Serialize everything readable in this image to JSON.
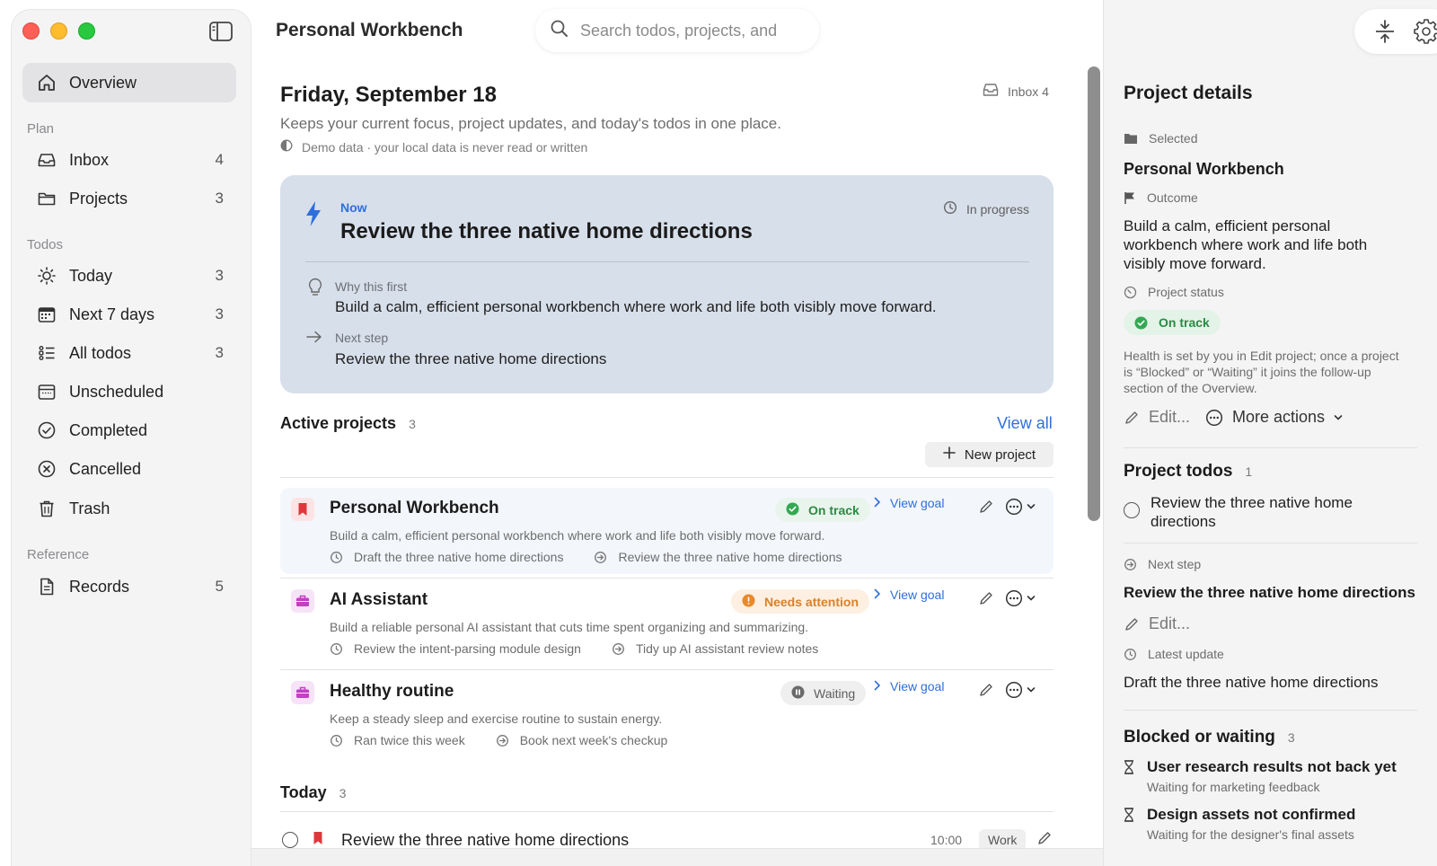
{
  "window": {
    "title": "Personal Workbench"
  },
  "search": {
    "placeholder": "Search todos, projects, and"
  },
  "sidebar": {
    "overview_label": "Overview",
    "sections": {
      "plan": "Plan",
      "todos": "Todos",
      "reference": "Reference"
    },
    "plan_items": [
      {
        "label": "Inbox",
        "count": "4",
        "icon": "inbox-icon"
      },
      {
        "label": "Projects",
        "count": "3",
        "icon": "folder-icon"
      }
    ],
    "todo_items": [
      {
        "label": "Today",
        "count": "3",
        "icon": "sun-icon"
      },
      {
        "label": "Next 7 days",
        "count": "3",
        "icon": "calendar-icon"
      },
      {
        "label": "All todos",
        "count": "3",
        "icon": "list-icon"
      },
      {
        "label": "Unscheduled",
        "count": "",
        "icon": "calendar-blank-icon"
      },
      {
        "label": "Completed",
        "count": "",
        "icon": "check-circle-icon"
      },
      {
        "label": "Cancelled",
        "count": "",
        "icon": "x-circle-icon"
      },
      {
        "label": "Trash",
        "count": "",
        "icon": "trash-icon"
      }
    ],
    "reference_items": [
      {
        "label": "Records",
        "count": "5",
        "icon": "document-icon"
      }
    ]
  },
  "main": {
    "date": "Friday, September 18",
    "inbox_chip": "Inbox 4",
    "subtitle": "Keeps your current focus, project updates, and today's todos in one place.",
    "demo_note": "Demo data · your local data is never read or written",
    "focus": {
      "now_label": "Now",
      "title": "Review the three native home directions",
      "status": "In progress",
      "why_label": "Why this first",
      "why_text": "Build a calm, efficient personal workbench where work and life both visibly move forward.",
      "next_label": "Next step",
      "next_text": "Review the three native home directions"
    },
    "active_projects": {
      "heading": "Active projects",
      "count": "3",
      "view_all": "View all",
      "new_project": "New project",
      "items": [
        {
          "name": "Personal Workbench",
          "status": "On track",
          "description": "Build a calm, efficient personal workbench where work and life both visibly move forward.",
          "latest": "Draft the three native home directions",
          "next": "Review the three native home directions",
          "view_goal": "View goal"
        },
        {
          "name": "AI Assistant",
          "status": "Needs attention",
          "description": "Build a reliable personal AI assistant that cuts time spent organizing and summarizing.",
          "latest": "Review the intent-parsing module design",
          "next": "Tidy up AI assistant review notes",
          "view_goal": "View goal"
        },
        {
          "name": "Healthy routine",
          "status": "Waiting",
          "description": "Keep a steady sleep and exercise routine to sustain energy.",
          "latest": "Ran twice this week",
          "next": "Book next week's checkup",
          "view_goal": "View goal"
        }
      ]
    },
    "today": {
      "heading": "Today",
      "count": "3",
      "items": [
        {
          "title": "Review the three native home directions",
          "time": "10:00",
          "tag": "Work"
        }
      ]
    }
  },
  "details": {
    "heading": "Project details",
    "selected_label": "Selected",
    "project_name": "Personal Workbench",
    "outcome_label": "Outcome",
    "outcome_text": "Build a calm, efficient personal workbench where work and life both visibly move forward.",
    "status_label": "Project status",
    "status_value": "On track",
    "status_note": "Health is set by you in Edit project; once a project is “Blocked” or “Waiting” it joins the follow-up section of the Overview.",
    "edit_label": "Edit...",
    "more_actions": "More actions",
    "todos_heading": "Project todos",
    "todos_count": "1",
    "todo_item": "Review the three native home directions",
    "next_step_label": "Next step",
    "next_step_text": "Review the three native home directions",
    "next_edit_label": "Edit...",
    "latest_label": "Latest update",
    "latest_text": "Draft the three native home directions",
    "blocked_heading": "Blocked or waiting",
    "blocked_count": "3",
    "blocked_items": [
      {
        "title": "User research results not back yet",
        "sub": "Waiting for marketing feedback"
      },
      {
        "title": "Design assets not confirmed",
        "sub": "Waiting for the designer's final assets"
      }
    ]
  },
  "colors": {
    "accent": "#2f6fdb",
    "on_track": "#2d8a45",
    "needs_attention": "#d9822b",
    "focus_card": "#d7dfea"
  }
}
